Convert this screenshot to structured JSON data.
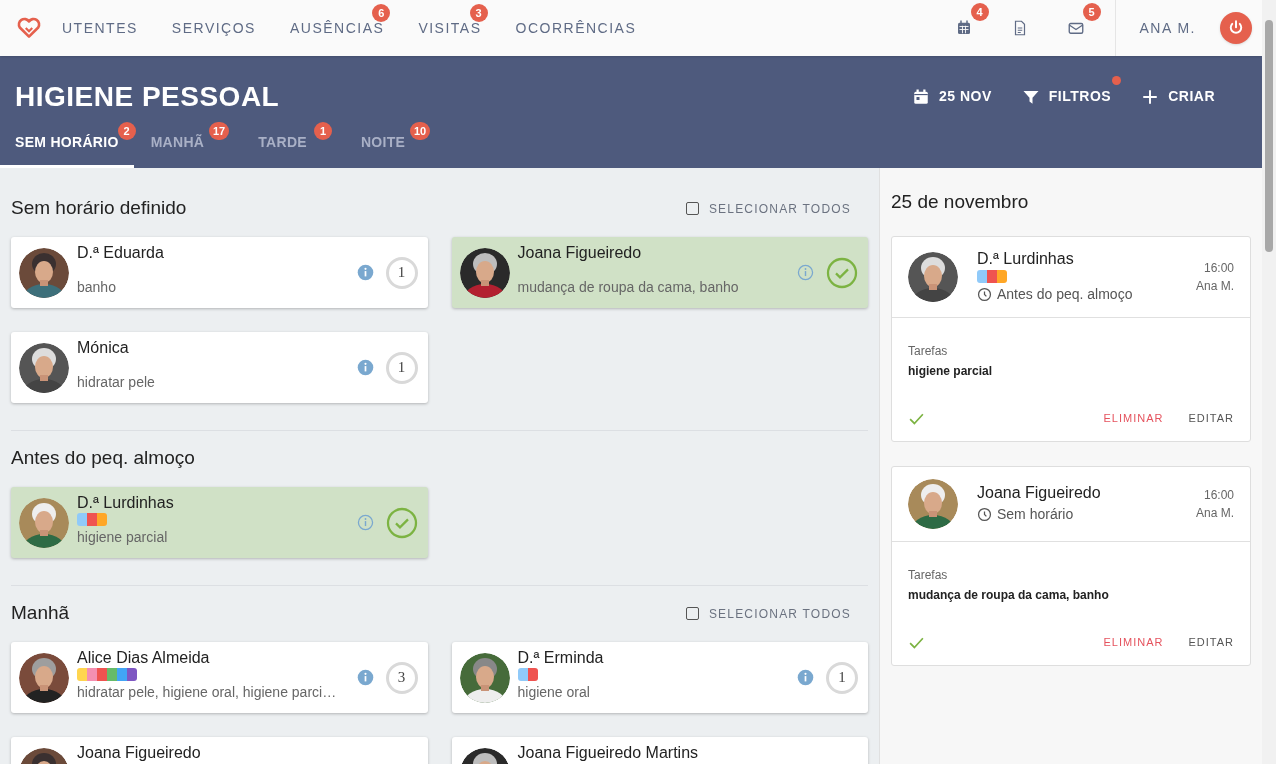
{
  "nav": {
    "items": [
      {
        "label": "UTENTES"
      },
      {
        "label": "SERVIÇOS"
      },
      {
        "label": "AUSÊNCIAS",
        "badge": "6"
      },
      {
        "label": "VISITAS",
        "badge": "3"
      },
      {
        "label": "OCORRÊNCIAS"
      }
    ],
    "icons": [
      {
        "kind": "calendar",
        "badge": "4"
      },
      {
        "kind": "document"
      },
      {
        "kind": "mail",
        "badge": "5"
      }
    ],
    "user": "ANA M."
  },
  "header": {
    "title": "HIGIENE PESSOAL",
    "actions": [
      {
        "kind": "date",
        "label": "25 NOV"
      },
      {
        "kind": "filter",
        "label": "FILTROS",
        "dot": true
      },
      {
        "kind": "create",
        "label": "CRIAR"
      }
    ],
    "tabs": [
      {
        "label": "SEM HORÁRIO",
        "badge": "2",
        "selected": true
      },
      {
        "label": "MANHÃ",
        "badge": "17",
        "selected": false
      },
      {
        "label": "TARDE",
        "badge": "1",
        "selected": false
      },
      {
        "label": "NOITE",
        "badge": "10",
        "selected": false
      }
    ]
  },
  "sections": [
    {
      "title": "Sem horário definido",
      "select_all": {
        "label": "SELECIONAR TODOS",
        "checked": false
      },
      "cards": [
        {
          "name": "D.ª Eduarda",
          "tasks": "banho",
          "done": false,
          "count": "1"
        },
        {
          "name": "Joana Figueiredo",
          "tasks": "mudança de roupa da cama, banho",
          "done": true
        },
        {
          "name": "Mónica",
          "tasks": "hidratar pele",
          "done": false,
          "count": "1"
        }
      ]
    },
    {
      "title": "Antes do peq. almoço",
      "cards": [
        {
          "name": "D.ª Lurdinhas",
          "tags": [
            {
              "color": "#90caf9"
            },
            {
              "color": "#ef5350"
            },
            {
              "color": "#ffa726"
            }
          ],
          "tasks": "higiene parcial",
          "done": true
        }
      ]
    },
    {
      "title": "Manhã",
      "select_all": {
        "label": "SELECIONAR TODOS",
        "checked": false
      },
      "cards": [
        {
          "name": "Alice Dias Almeida",
          "tags": [
            {
              "color": "#ffd54f"
            },
            {
              "color": "#f48fb1"
            },
            {
              "color": "#ef5350"
            },
            {
              "color": "#66bb6a"
            },
            {
              "color": "#42a5f5"
            },
            {
              "color": "#7e57c2"
            }
          ],
          "tasks": "hidratar pele, higiene oral, higiene parci…",
          "done": false,
          "count": "3"
        },
        {
          "name": "D.ª Erminda",
          "tags": [
            {
              "color": "#90caf9"
            },
            {
              "color": "#ef5350"
            }
          ],
          "tasks": "higiene oral",
          "done": false,
          "count": "1"
        },
        {
          "name": "Joana Figueiredo"
        },
        {
          "name": "Joana Figueiredo Martins"
        }
      ]
    }
  ],
  "panel": {
    "heading": "25 de novembro",
    "entries": [
      {
        "name": "D.ª Lurdinhas",
        "tags": [
          {
            "color": "#90caf9"
          },
          {
            "color": "#ef5350"
          },
          {
            "color": "#ffa726"
          }
        ],
        "slot": "Antes do peq. almoço",
        "time": "16:00",
        "author": "Ana M.",
        "tasks_label": "Tarefas",
        "tasks": "higiene parcial",
        "done": true,
        "delete": "ELIMINAR",
        "edit": "EDITAR"
      },
      {
        "name": "Joana Figueiredo",
        "slot": "Sem horário",
        "time": "16:00",
        "author": "Ana M.",
        "tasks_label": "Tarefas",
        "tasks": "mudança de roupa da cama, banho",
        "done": true,
        "delete": "ELIMINAR",
        "edit": "EDITAR"
      }
    ]
  }
}
